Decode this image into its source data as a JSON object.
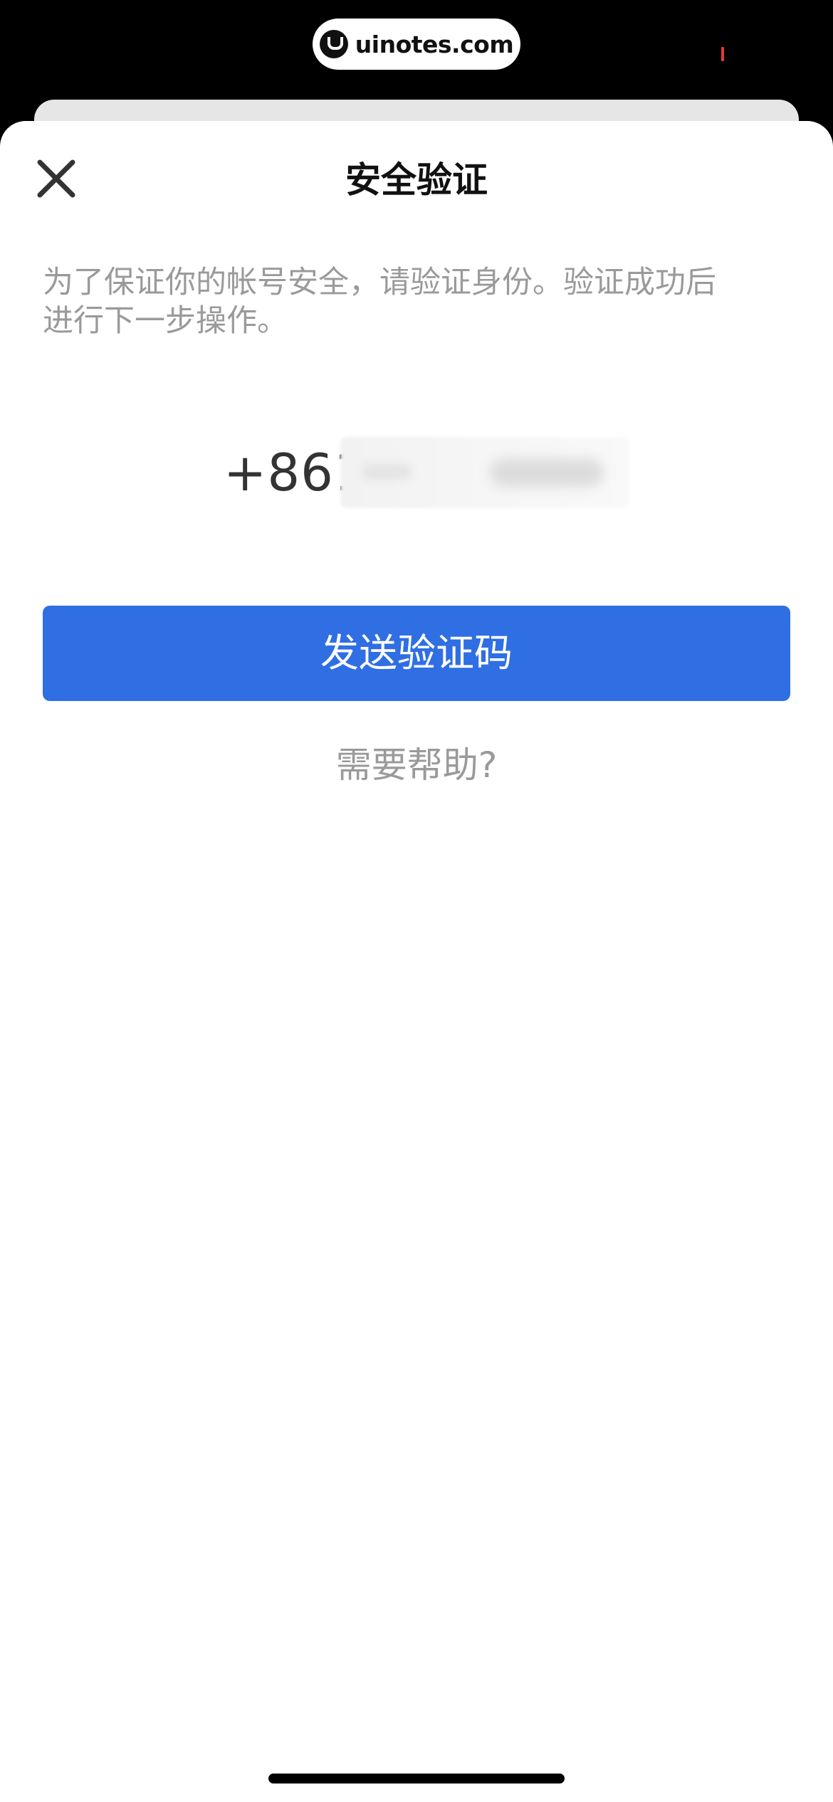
{
  "watermark": {
    "text": "uinotes.com",
    "logo_icon": "uinotes-logo-icon"
  },
  "header": {
    "title": "安全验证",
    "close_icon": "close-icon"
  },
  "description": {
    "line1": "为了保证你的帐号安全，请验证身份。验证成功后",
    "line2": "进行下一步操作。"
  },
  "phone": {
    "prefix": "+861"
  },
  "actions": {
    "send_code_label": "发送验证码",
    "help_label": "需要帮助?"
  },
  "colors": {
    "primary": "#306ee3",
    "muted_text": "#9a9a9a",
    "title_text": "#111111"
  }
}
